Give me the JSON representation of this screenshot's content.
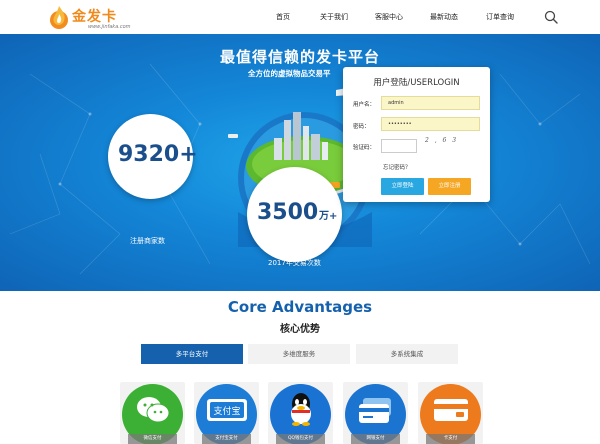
{
  "header": {
    "logo_name": "金发卡",
    "logo_url": "www.jinfaka.com",
    "nav": [
      "首页",
      "关于我们",
      "客服中心",
      "最新动态",
      "订单查询"
    ],
    "search_icon": "search-icon"
  },
  "hero": {
    "title": "最值得信赖的发卡平台",
    "subtitle": "全方位的虚拟物品交易平",
    "stat1_value": "9320+",
    "stat1_label": "注册商家数",
    "stat2_value": "3500",
    "stat2_unit": "万+",
    "stat2_label": "2017年交易次数"
  },
  "login": {
    "title": "用户登陆/USERLOGIN",
    "username_label": "用户名：",
    "username_value": "admin",
    "password_label": "密码：",
    "password_value": "••••••••",
    "captcha_label": "验证码：",
    "captcha_text": "2 , 6   3",
    "forgot_link": "忘记密码？",
    "login_button": "立即登陆",
    "register_button": "立即注册"
  },
  "core": {
    "title": "Core Advantages",
    "subtitle": "核心优势",
    "tabs": [
      "多平台支付",
      "多维度服务",
      "多系统集成"
    ],
    "payments": [
      "微信支付",
      "支付宝支付",
      "QQ钱包支付",
      "网银支付",
      "卡支付"
    ]
  },
  "colors": {
    "brand_orange": "#f08a1c",
    "hero_blue": "#1487d8",
    "tab_active": "#1561ad",
    "btn_login": "#29a7e1",
    "btn_register": "#f5a623"
  }
}
